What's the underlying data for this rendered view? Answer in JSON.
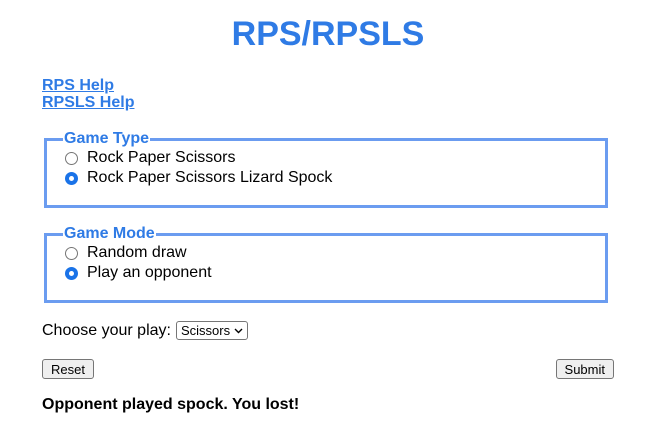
{
  "title": "RPS/RPSLS",
  "help_links": [
    "RPS Help",
    "RPSLS Help"
  ],
  "game_type": {
    "legend": "Game Type",
    "options": [
      "Rock Paper Scissors",
      "Rock Paper Scissors Lizard Spock"
    ],
    "selected_index": 1
  },
  "game_mode": {
    "legend": "Game Mode",
    "options": [
      "Random draw",
      "Play an opponent"
    ],
    "selected_index": 1
  },
  "play": {
    "label": "Choose your play:",
    "selected": "Scissors"
  },
  "buttons": {
    "reset": "Reset",
    "submit": "Submit"
  },
  "result": "Opponent played spock. You lost!",
  "colors": {
    "accent": "#2f7be5",
    "fieldset_border": "#6b9cf0"
  }
}
